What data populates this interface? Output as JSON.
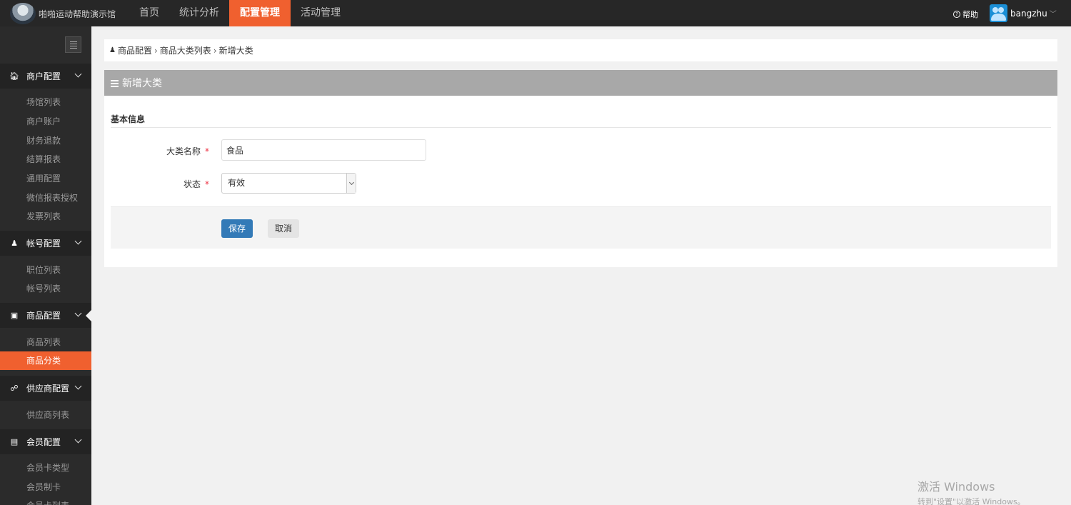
{
  "header": {
    "brand": "啪啪运动帮助演示馆",
    "nav": [
      {
        "label": "首页",
        "active": false
      },
      {
        "label": "统计分析",
        "active": false
      },
      {
        "label": "配置管理",
        "active": true
      },
      {
        "label": "活动管理",
        "active": false
      }
    ],
    "help_label": "帮助",
    "username": "bangzhu"
  },
  "sidebar": {
    "groups": [
      {
        "title": "商户配置",
        "icon": "home-icon",
        "items": [
          "场馆列表",
          "商户账户",
          "财务退款",
          "结算报表",
          "通用配置",
          "微信报表授权",
          "发票列表"
        ]
      },
      {
        "title": "帐号配置",
        "icon": "user-icon",
        "items": [
          "职位列表",
          "帐号列表"
        ]
      },
      {
        "title": "商品配置",
        "icon": "gift-icon",
        "items": [
          "商品列表",
          "商品分类"
        ]
      },
      {
        "title": "供应商配置",
        "icon": "link-icon",
        "items": [
          "供应商列表"
        ]
      },
      {
        "title": "会员配置",
        "icon": "id-card-icon",
        "items": [
          "会员卡类型",
          "会员制卡",
          "会员卡列表"
        ]
      }
    ],
    "active_item": "商品分类"
  },
  "breadcrumb": [
    "商品配置",
    "商品大类列表",
    "新增大类"
  ],
  "panel": {
    "title": "新增大类",
    "section_title": "基本信息",
    "fields": {
      "name_label": "大类名称",
      "name_value": "食品",
      "status_label": "状态",
      "status_value": "有效"
    },
    "save_label": "保存",
    "cancel_label": "取消"
  },
  "watermark": {
    "line1": "激活 Windows",
    "line2": "转到\"设置\"以激活 Windows。"
  },
  "colors": {
    "accent": "#f0602f",
    "topbar": "#272727",
    "sidebar": "#2b2b2b",
    "primary_button": "#337ab7",
    "panel_header": "#a8a8a8"
  }
}
